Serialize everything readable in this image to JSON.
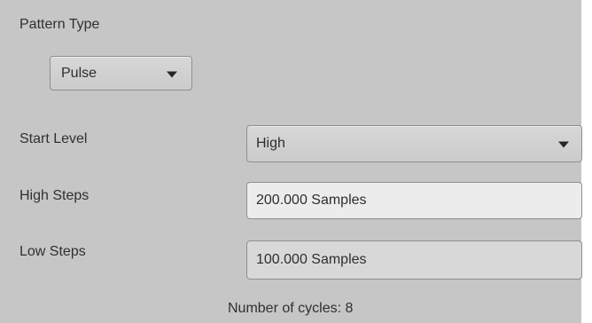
{
  "pattern_type": {
    "label": "Pattern Type",
    "selected": "Pulse"
  },
  "start_level": {
    "label": "Start Level",
    "selected": "High"
  },
  "high_steps": {
    "label": "High Steps",
    "value": "200.000 Samples"
  },
  "low_steps": {
    "label": "Low Steps",
    "value": "100.000 Samples"
  },
  "footer": {
    "cycles_text": "Number of cycles: 8"
  },
  "icons": {
    "dropdown_arrow": "triangle-down-icon"
  },
  "colors": {
    "panel_background": "#c6c6c6",
    "field_background": "#ececec",
    "text": "#303030"
  }
}
